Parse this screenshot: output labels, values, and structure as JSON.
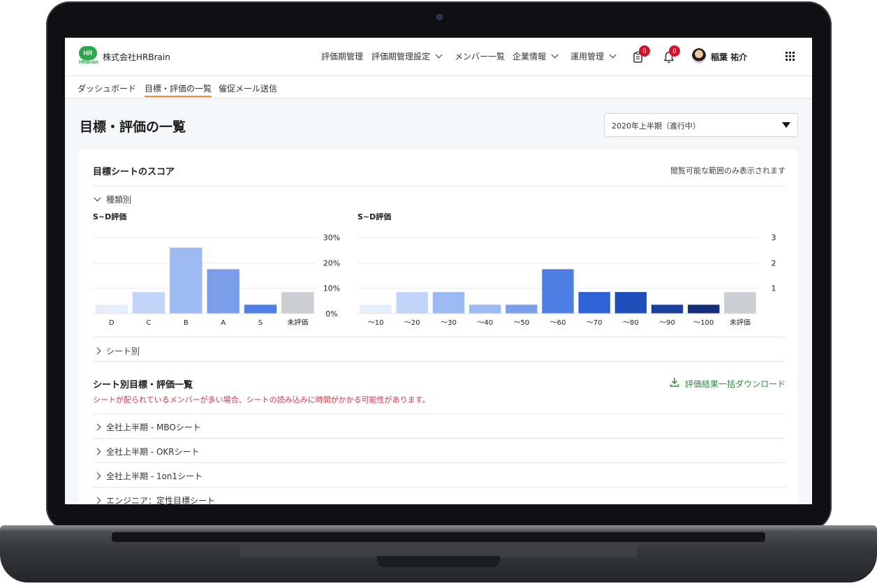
{
  "header": {
    "logo_text": "HR",
    "logo_sub": "HRBrain",
    "company": "株式会社HRBrain",
    "nav": [
      "評価期管理",
      "評価期管理設定",
      "メンバー一覧",
      "企業情報",
      "運用管理"
    ],
    "task_badge": "0",
    "notification_badge": "0",
    "user_name": "稲葉 祐介"
  },
  "subnav": [
    "ダッシュボード",
    "目標・評価の一覧",
    "催促メール送信"
  ],
  "page": {
    "title": "目標・評価の一覧",
    "period_select": "2020年上半期（進行中）"
  },
  "card": {
    "title": "目標シートのスコア",
    "note": "閲覧可能な範囲のみ表示されます",
    "toggle_type": "種類別",
    "toggle_sheet": "シート別"
  },
  "chart_data": [
    {
      "type": "bar",
      "title": "S~D評価",
      "categories": [
        "D",
        "C",
        "B",
        "A",
        "S",
        "未評価"
      ],
      "values": [
        3.5,
        8.5,
        26,
        17.5,
        3.5,
        8.5
      ],
      "ylim": [
        0,
        30
      ],
      "yticks": [
        "0%",
        "10%",
        "20%",
        "30%"
      ],
      "colors": [
        "#e6edfb",
        "#c2d4f7",
        "#9cb9f1",
        "#7a9eea",
        "#4f7ee3",
        "#cdced3"
      ],
      "grid": true
    },
    {
      "type": "bar",
      "title": "S~D評価",
      "categories": [
        "〜10",
        "〜20",
        "〜30",
        "〜40",
        "〜50",
        "〜60",
        "〜70",
        "〜80",
        "〜90",
        "〜100",
        "未評価"
      ],
      "values": [
        0.35,
        0.85,
        0.85,
        0.35,
        0.35,
        1.75,
        0.85,
        0.85,
        0.35,
        0.35,
        0.85
      ],
      "ylim": [
        0,
        3
      ],
      "yticks": [
        "1",
        "2",
        "3"
      ],
      "colors": [
        "#e6edfb",
        "#c2d4f7",
        "#9cb9f1",
        "#9cb9f1",
        "#7a9eea",
        "#4f7ee3",
        "#2f62d6",
        "#1f4fba",
        "#1a3f9c",
        "#142f7a",
        "#cdced3"
      ],
      "grid": true
    }
  ],
  "sheets": {
    "title": "シート別目標・評価一覧",
    "warning": "シートが配られているメンバーが多い場合、シートの読み込みに時間がかかる可能性があります。",
    "download_label": "評価結果一括ダウンロード",
    "rows": [
      "全社上半期 - MBOシート",
      "全社上半期 - OKRシート",
      "全社上半期 - 1on1シート",
      "エンジニア：定性目標シート"
    ]
  }
}
